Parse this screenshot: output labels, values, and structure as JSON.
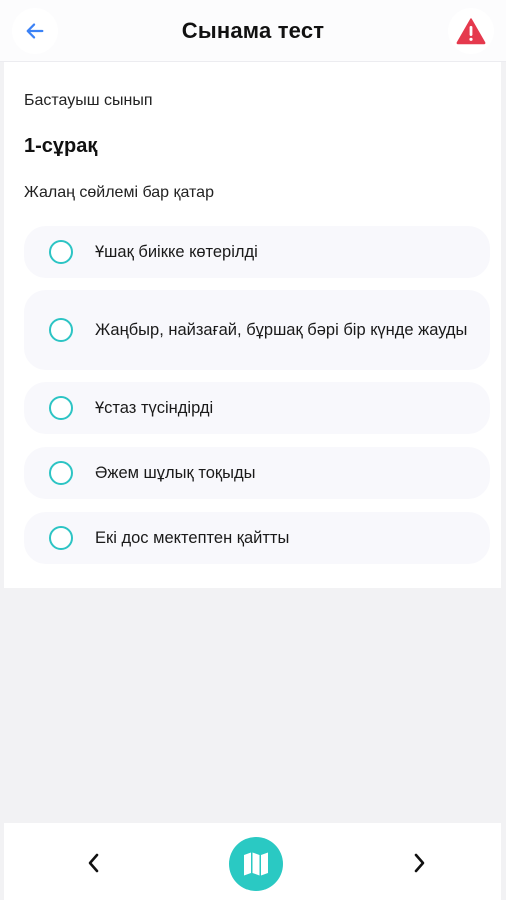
{
  "header": {
    "title": "Сынама тест",
    "back_icon": "arrow-left-icon",
    "report_icon": "warning-triangle-icon"
  },
  "question": {
    "grade": "Бастауыш сынып",
    "number": "1-сұрақ",
    "text": "Жалаң сөйлемі бар қатар",
    "options": [
      "Ұшақ биікке көтерілді",
      "Жаңбыр, найзағай, бұршақ бәрі бір күнде жауды",
      "Ұстаз түсіндірді",
      "Әжем шұлық тоқыды",
      "Екі дос мектептен қайтты"
    ]
  },
  "footer": {
    "prev_icon": "chevron-left-icon",
    "map_icon": "map-icon",
    "next_icon": "chevron-right-icon"
  },
  "colors": {
    "accent": "#2ac9c3",
    "radio_border": "#2cc4c4",
    "back_arrow": "#3b82f6",
    "warning": "#e5394d",
    "option_bg": "#f8f8fc",
    "page_bg": "#f2f2f4"
  }
}
